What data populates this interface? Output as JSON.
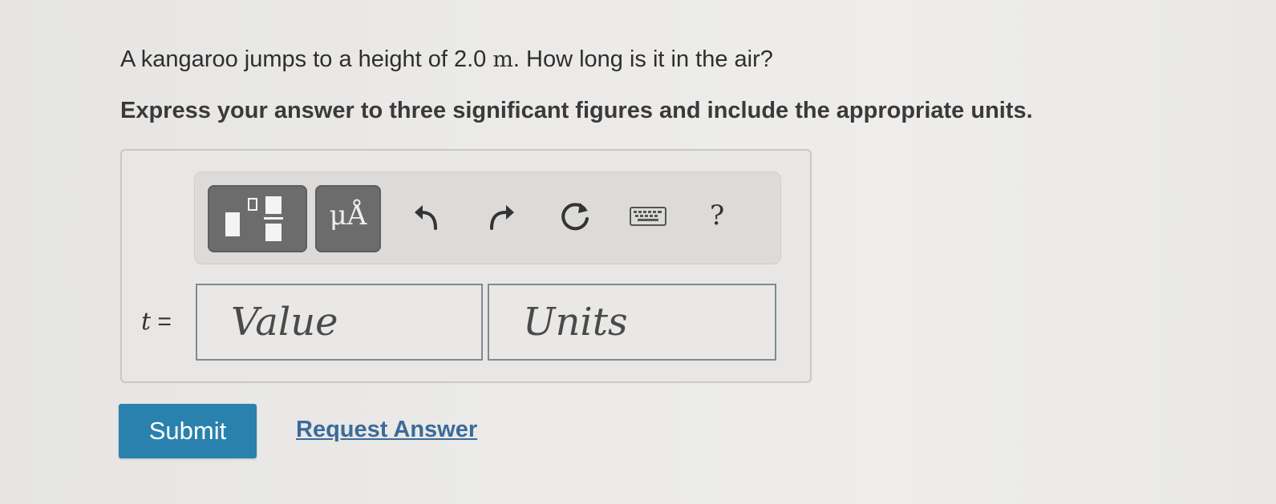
{
  "question": {
    "text_before": "A kangaroo jumps to a height of 2.0 ",
    "unit": "m",
    "text_after": ".  How long is it in the air?"
  },
  "instruction": "Express your answer to three significant figures and include the appropriate units.",
  "toolbar": {
    "templates_icon": "fraction-templates-icon",
    "units_label": "μÅ",
    "undo_icon": "undo-icon",
    "redo_icon": "redo-icon",
    "reset_icon": "reset-icon",
    "keyboard_icon": "keyboard-icon",
    "help_label": "?"
  },
  "answer": {
    "variable": "t",
    "equals": " =",
    "value_placeholder": "Value",
    "units_placeholder": "Units"
  },
  "actions": {
    "submit_label": "Submit",
    "request_answer_label": "Request Answer"
  },
  "colors": {
    "submit_bg": "#2a81ad",
    "link": "#3b6b9a",
    "toolbar_button": "#6c6c6c"
  }
}
